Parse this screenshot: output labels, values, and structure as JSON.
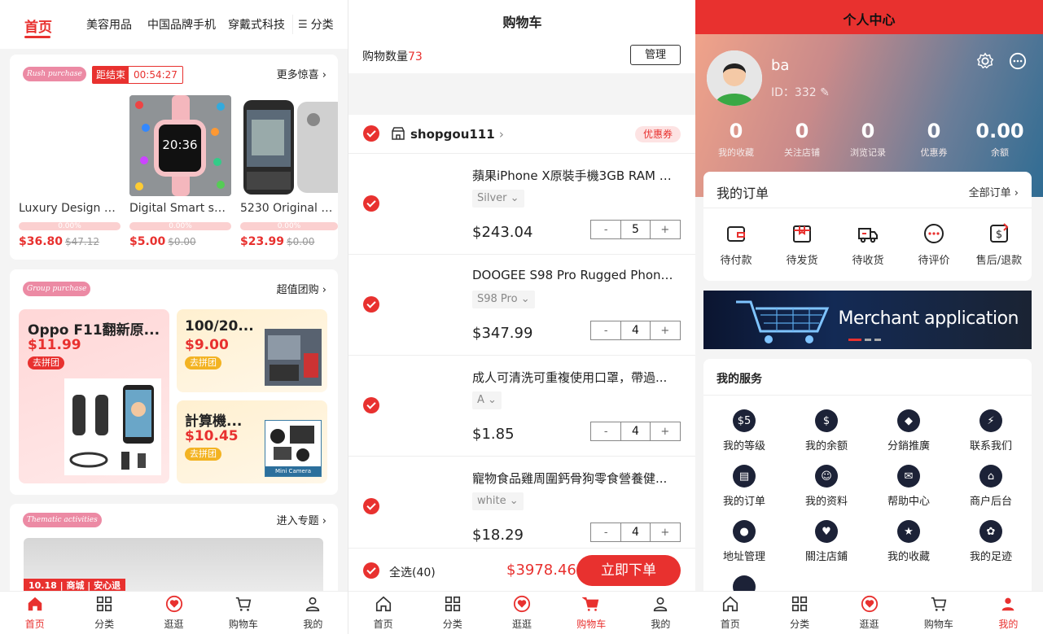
{
  "home": {
    "top_tabs": [
      "首页",
      "美容用品",
      "中国品牌手机",
      "穿戴式科技"
    ],
    "category_label": "分类",
    "rush": {
      "badge": "Rush purchase",
      "ends_label": "距结束",
      "countdown": "00:54:27",
      "more": "更多惊喜",
      "products": [
        {
          "name": "Luxury Design M...",
          "progress_label": "0.00%",
          "price": "$36.80",
          "original": "$47.12"
        },
        {
          "name": "Digital Smart sp...",
          "progress_label": "0.00%",
          "price": "$5.00",
          "original": "$0.00"
        },
        {
          "name": "5230 Original Un...",
          "progress_label": "0.00%",
          "price": "$23.99",
          "original": "$0.00"
        }
      ]
    },
    "group": {
      "badge": "Group purchase",
      "more": "超值团购",
      "deals": [
        {
          "title": "Oppo F11翻新原...",
          "price": "$11.99",
          "button": "去拼团"
        },
        {
          "title": "100/20...",
          "price": "$9.00",
          "button": "去拼团"
        },
        {
          "title": "計算機...",
          "price": "$10.45",
          "button": "去拼团"
        }
      ],
      "image_caption": "Mini Camera"
    },
    "thematic": {
      "badge": "Thematic activities",
      "more": "进入专题",
      "banner_text": "10.18 | 商城 | 安心退"
    }
  },
  "cart": {
    "title": "购物车",
    "count_label": "购物数量",
    "count": "73",
    "manage": "管理",
    "shop_name": "shopgou111",
    "coupon": "优惠券",
    "items": [
      {
        "name": "蘋果iPhone X原裝手機3GB RAM 6...",
        "sku": "Silver",
        "price": "$243.04",
        "qty": "5"
      },
      {
        "name": "DOOGEE S98 Pro Rugged Phone ...",
        "sku": "S98 Pro",
        "price": "$347.99",
        "qty": "4"
      },
      {
        "name": "成人可清洗可重複使用口罩，帶過...",
        "sku": "A",
        "price": "$1.85",
        "qty": "4"
      },
      {
        "name": "寵物食品雞周圍鈣骨狗零食營養健...",
        "sku": "white",
        "price": "$18.29",
        "qty": "4"
      }
    ],
    "select_all": "全选(40)",
    "total": "$3978.46",
    "checkout": "立即下单"
  },
  "profile": {
    "title": "个人中心",
    "username": "ba",
    "user_id": "ID：332",
    "stats": [
      {
        "value": "0",
        "label": "我的收藏"
      },
      {
        "value": "0",
        "label": "关注店铺"
      },
      {
        "value": "0",
        "label": "浏览记录"
      },
      {
        "value": "0",
        "label": "优惠券"
      },
      {
        "value": "0.00",
        "label": "余额"
      }
    ],
    "orders_title": "我的订单",
    "orders_all": "全部订单",
    "order_states": [
      "待付款",
      "待发货",
      "待收货",
      "待评价",
      "售后/退款"
    ],
    "banner": "Merchant application",
    "services_title": "我的服务",
    "services": [
      {
        "label": "我的等级",
        "glyph": "$5"
      },
      {
        "label": "我的余额",
        "glyph": "$"
      },
      {
        "label": "分銷推廣",
        "glyph": "◆"
      },
      {
        "label": "联系我们",
        "glyph": "⚡"
      },
      {
        "label": "我的订单",
        "glyph": "▤"
      },
      {
        "label": "我的资料",
        "glyph": "☺"
      },
      {
        "label": "帮助中心",
        "glyph": "✉"
      },
      {
        "label": "商户后台",
        "glyph": "⌂"
      },
      {
        "label": "地址管理",
        "glyph": "●"
      },
      {
        "label": "關注店鋪",
        "glyph": "♥"
      },
      {
        "label": "我的收藏",
        "glyph": "★"
      },
      {
        "label": "我的足迹",
        "glyph": "✿"
      }
    ]
  },
  "tabbar": [
    "首页",
    "分类",
    "逛逛",
    "购物车",
    "我的"
  ],
  "colors": {
    "accent": "#e8312f",
    "dark_icon": "#1c2237",
    "gradient_from": "#f0a38a",
    "gradient_to": "#2f6c93"
  }
}
